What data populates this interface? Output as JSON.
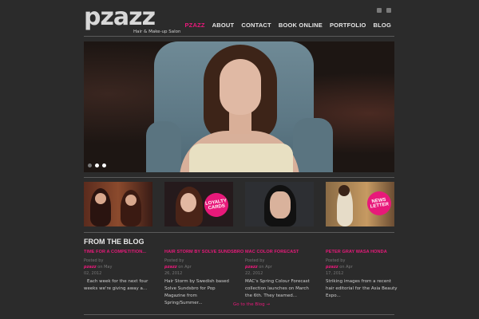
{
  "header": {
    "logo": "pzazz",
    "tagline": "Hair & Make-up Salon",
    "nav": [
      "PZAZZ",
      "ABOUT",
      "CONTACT",
      "BOOK ONLINE",
      "PORTFOLIO",
      "BLOG"
    ],
    "active_nav": "PZAZZ"
  },
  "slider": {
    "current_slide": 2,
    "slide_count": 3
  },
  "thumbnails": {
    "loyalty_badge": "LOYALTY CARDS",
    "newsletter_badge": "NEWS LETTER"
  },
  "blog": {
    "title": "FROM THE BLOG",
    "posts": [
      {
        "title": "TIME FOR A COMPETITION...",
        "posted": "Posted by",
        "author": "pzazz",
        "on": "on May",
        "date": "02, 2012",
        "excerpt": "Each week for the next four weeks we're giving away a..."
      },
      {
        "title": "HAIR STORM BY SOLVE SUNDSBRO",
        "posted": "Posted by",
        "author": "pzazz",
        "on": "on Apr",
        "date": "26, 2012",
        "excerpt": "Hair Storm by Swedish based Solve Sundsbro for Pop Magazine from Spring/Summer..."
      },
      {
        "title": "MAC COLOR FORECAST",
        "posted": "Posted by",
        "author": "pzazz",
        "on": "on Apr",
        "date": "22, 2012",
        "excerpt": "MAC's Spring Colour Forecast collection launches on March the 6th. They teamed..."
      },
      {
        "title": "PETER GRAY WASA HONDA",
        "posted": "Posted by",
        "author": "pzazz",
        "on": "on Apr",
        "date": "17, 2012",
        "excerpt": "Striking images from a recent hair editorial for the Asia Beauty Expo..."
      }
    ],
    "goto_link": "Go to the Blog →"
  },
  "colors": {
    "accent": "#e8197a",
    "background": "#2b2b2b"
  }
}
